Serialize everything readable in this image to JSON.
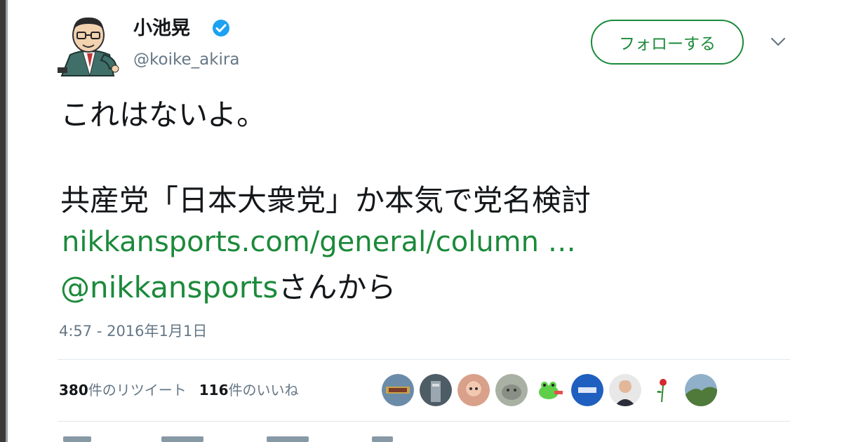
{
  "user": {
    "display_name": "小池晃",
    "handle": "@koike_akira",
    "verified": true,
    "avatar_icon": "cartoon-portrait-avatar"
  },
  "follow_button": {
    "label": "フォローする"
  },
  "menu": {
    "icon": "chevron-down-icon"
  },
  "tweet": {
    "line1": "これはないよ。",
    "line2": "共産党「日本大衆党」か本気で党名検討",
    "link": "nikkansports.com/general/column …",
    "mention": "@nikkansports",
    "mention_suffix": "さんから",
    "timestamp": "4:57 - 2016年1月1日"
  },
  "stats": {
    "retweets_count": "380",
    "retweets_label": "件のリツイート",
    "likes_count": "116",
    "likes_label": "件のいいね"
  },
  "likers": [
    "liker-avatar-1",
    "liker-avatar-2",
    "liker-avatar-3",
    "liker-avatar-4",
    "liker-avatar-5",
    "liker-avatar-6",
    "liker-avatar-7",
    "liker-avatar-8",
    "liker-avatar-9"
  ],
  "colors": {
    "accent": "#1b8a3a",
    "text": "#14171a",
    "secondary": "#657786",
    "verified": "#1da1f2"
  }
}
